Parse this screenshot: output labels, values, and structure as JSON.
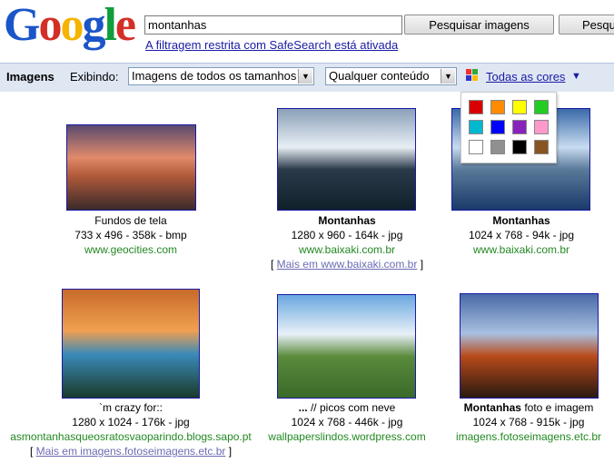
{
  "logo_text": [
    "G",
    "o",
    "o",
    "g",
    "l",
    "e"
  ],
  "search": {
    "query": "montanhas",
    "button_images": "Pesquisar imagens",
    "button_web": "Pesqu"
  },
  "safesearch_notice": "A filtragem restrita com SafeSearch está ativada",
  "toolbar": {
    "title": "Imagens",
    "showing_label": "Exibindo:",
    "size_select": "Imagens de todos os tamanhos",
    "content_select": "Qualquer conteúdo",
    "colors_link": "Todas as cores",
    "colors_caret": "▼"
  },
  "palette": {
    "colors": [
      "#d80000",
      "#ff8c00",
      "#ffff00",
      "#22cc22",
      "#00b8d0",
      "#0000ff",
      "#8822bb",
      "#ff99cc",
      "#ffffff",
      "#909090",
      "#000000",
      "#885522"
    ]
  },
  "results": [
    {
      "title": "Fundos de tela",
      "title_bold": false,
      "dims": "733 x 496 - 358k - bmp",
      "site": "www.geocities.com",
      "more": "",
      "palette": [
        "#5a4a6e",
        "#e08a6a",
        "#b05a3a",
        "#3a2a2a"
      ]
    },
    {
      "title": "Montanhas",
      "title_bold": true,
      "dims": "1280 x 960 - 164k - jpg",
      "site": "www.baixaki.com.br",
      "more": "Mais em www.baixaki.com.br",
      "palette": [
        "#8aa0b8",
        "#e8eef4",
        "#2a3a4a",
        "#10202a"
      ]
    },
    {
      "title": "Montanhas",
      "title_bold": true,
      "dims": "1024 x 768 - 94k - jpg",
      "site": "www.baixaki.com.br",
      "more": "",
      "palette": [
        "#3a6aa8",
        "#c8dcf0",
        "#5a7a9a",
        "#1a3a6a"
      ]
    },
    {
      "title": "`m crazy for::",
      "title_bold": false,
      "dims": "1280 x 1024 - 176k - jpg",
      "site": "asmontanhasqueosratosvaoparindo.blogs.sapo.pt",
      "more": "Mais em imagens.fotoseimagens.etc.br",
      "palette": [
        "#c86a2a",
        "#f0a050",
        "#3a8ab8",
        "#1a3a2a"
      ]
    },
    {
      "title_prefix": "...",
      "title": " // picos com neve",
      "title_bold": false,
      "dims": "1024 x 768 - 446k - jpg",
      "site": "wallpaperslindos.wordpress.com",
      "more": "",
      "palette": [
        "#6aa8e0",
        "#e8f0f8",
        "#5a8a3a",
        "#3a6a2a"
      ]
    },
    {
      "title": "Montanhas",
      "title_rest": " foto e imagem",
      "title_bold": true,
      "dims": "1024 x 768 - 915k - jpg",
      "site": "imagens.fotoseimagens.etc.br",
      "more": "",
      "palette": [
        "#4a6aa8",
        "#a8c0e0",
        "#b84a1a",
        "#2a1a10"
      ]
    }
  ]
}
